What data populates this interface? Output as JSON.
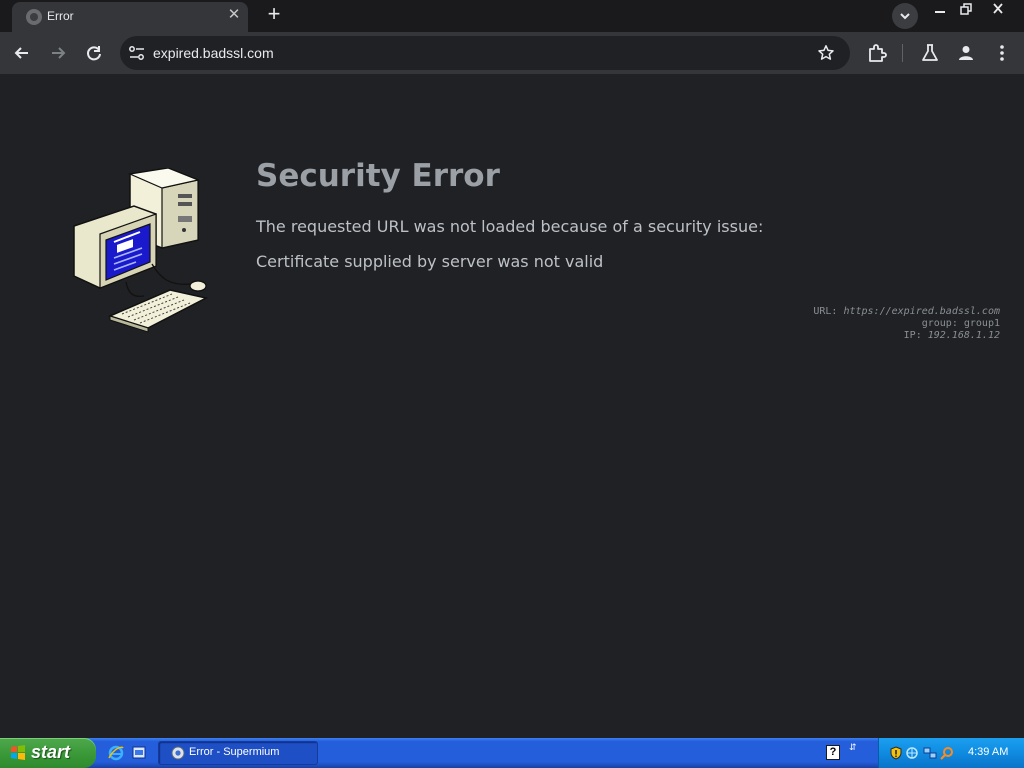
{
  "browser": {
    "tab": {
      "title": "Error",
      "favicon": "globe-icon"
    },
    "url": "expired.badssl.com"
  },
  "page": {
    "title": "Security Error",
    "description": "The requested URL was not loaded because of a security issue:",
    "detail": "Certificate supplied by server was not valid",
    "meta": {
      "url_label": "URL:",
      "url_value": "https://expired.badssl.com",
      "group_label": "group:",
      "group_value": "group1",
      "ip_label": "IP:",
      "ip_value": "192.168.1.12"
    }
  },
  "taskbar": {
    "start_label": "start",
    "task_label": "Error - Supermium",
    "clock": "4:39 AM",
    "help_glyph": "?"
  },
  "colors": {
    "page_background": "#202124",
    "title_text": "#9aa0a6",
    "taskbar_blue": "#245edb",
    "start_green": "#3c9a3a"
  }
}
